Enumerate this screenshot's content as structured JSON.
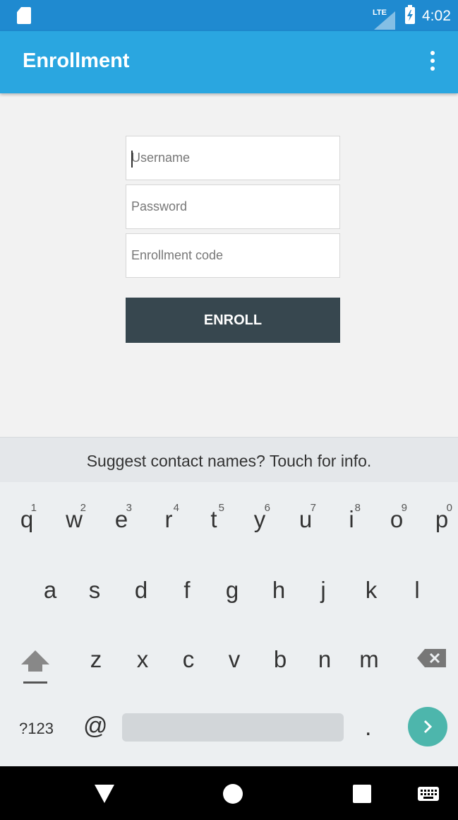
{
  "status_bar": {
    "network": "LTE",
    "time": "4:02",
    "icons": [
      "sd-card-icon",
      "signal-icon",
      "battery-charging-icon"
    ]
  },
  "app_bar": {
    "title": "Enrollment",
    "menu_icon": "overflow-menu-icon"
  },
  "form": {
    "username": {
      "placeholder": "Username",
      "value": ""
    },
    "password": {
      "placeholder": "Password",
      "value": ""
    },
    "enrollment_code": {
      "placeholder": "Enrollment code",
      "value": ""
    },
    "submit_label": "ENROLL"
  },
  "keyboard": {
    "suggestion": "Suggest contact names? Touch for info.",
    "row1": [
      {
        "key": "q",
        "hint": "1"
      },
      {
        "key": "w",
        "hint": "2"
      },
      {
        "key": "e",
        "hint": "3"
      },
      {
        "key": "r",
        "hint": "4"
      },
      {
        "key": "t",
        "hint": "5"
      },
      {
        "key": "y",
        "hint": "6"
      },
      {
        "key": "u",
        "hint": "7"
      },
      {
        "key": "i",
        "hint": "8"
      },
      {
        "key": "o",
        "hint": "9"
      },
      {
        "key": "p",
        "hint": "0"
      }
    ],
    "row2": [
      "a",
      "s",
      "d",
      "f",
      "g",
      "h",
      "j",
      "k",
      "l"
    ],
    "row3": [
      "z",
      "x",
      "c",
      "v",
      "b",
      "n",
      "m"
    ],
    "symbols_label": "?123",
    "at_label": "@",
    "period_label": ".",
    "accent_color": "#4db6ac"
  },
  "nav_bar": {
    "icons": [
      "back-icon",
      "home-icon",
      "recents-icon",
      "keyboard-switch-icon"
    ]
  }
}
